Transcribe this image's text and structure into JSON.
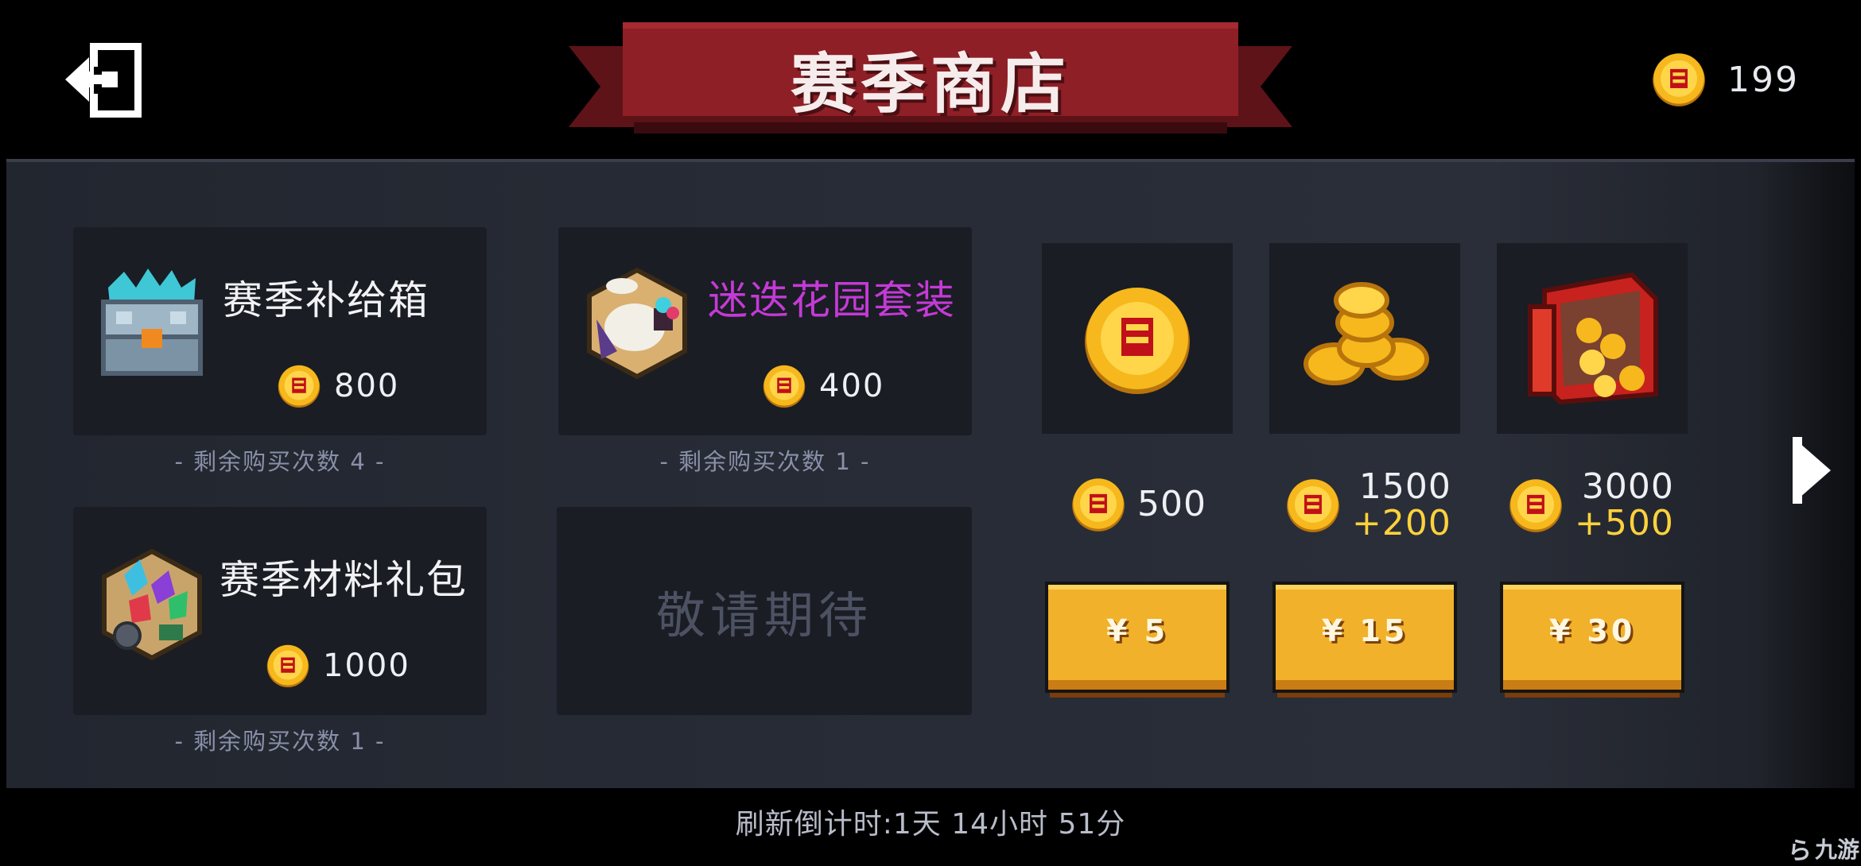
{
  "header": {
    "title": "赛季商店",
    "currency_value": "199"
  },
  "shop_items": [
    {
      "name": "赛季补给箱",
      "price": "800",
      "remaining": "- 剩余购买次数 4 -"
    },
    {
      "name": "迷迭花园套装",
      "price": "400",
      "remaining": "- 剩余购买次数 1 -"
    },
    {
      "name": "赛季材料礼包",
      "price": "1000",
      "remaining": "- 剩余购买次数 1 -"
    }
  ],
  "coming_soon": "敬请期待",
  "coin_packs": [
    {
      "amount": "500",
      "bonus": "",
      "price_label": "¥ 5"
    },
    {
      "amount": "1500",
      "bonus": "+200",
      "price_label": "¥ 15"
    },
    {
      "amount": "3000",
      "bonus": "+500",
      "price_label": "¥ 30"
    }
  ],
  "footer": {
    "refresh_timer": "刷新倒计时:1天 14小时 51分",
    "watermark": "九游"
  },
  "colors": {
    "banner_red": "#8e1f26",
    "coin_gold": "#f6b81c",
    "button_gold": "#f2b12a",
    "bonus_yellow": "#ffd23c",
    "special_item_purple": "#c43ad6"
  },
  "icons": {
    "exit": "exit-door-icon",
    "coin": "gold-coin-icon",
    "next": "chevron-right-icon"
  }
}
